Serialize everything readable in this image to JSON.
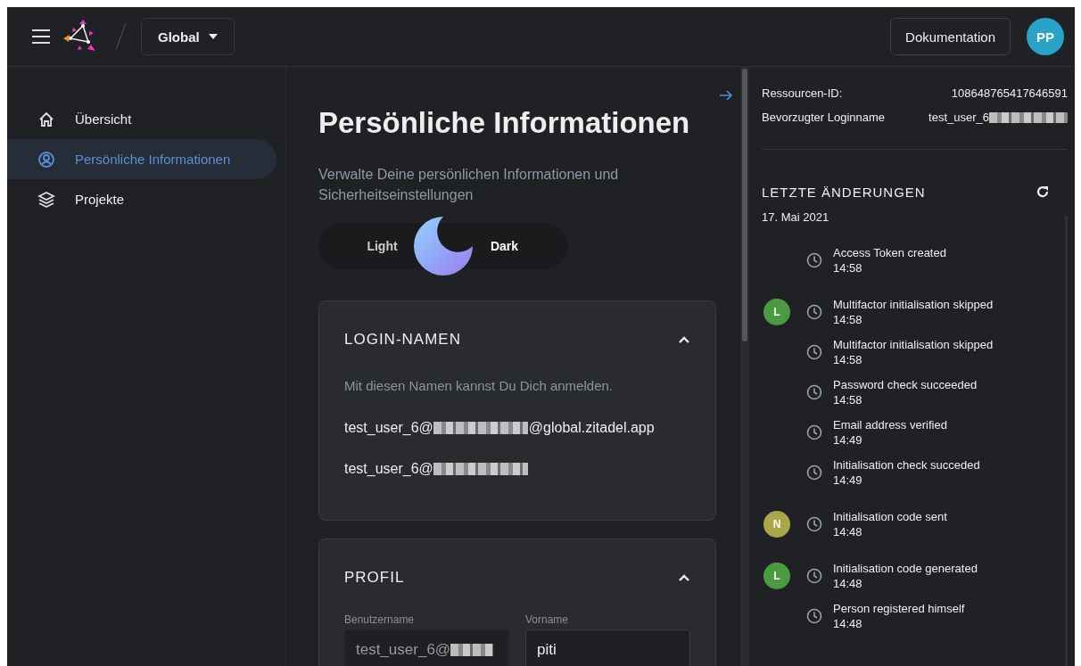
{
  "topbar": {
    "org_button": "Global",
    "docs_button": "Dokumentation",
    "avatar": "PP"
  },
  "sidebar": {
    "items": [
      {
        "label": "Übersicht",
        "kind": "home",
        "selected": false
      },
      {
        "label": "Persönliche Informationen",
        "kind": "person",
        "selected": true
      },
      {
        "label": "Projekte",
        "kind": "layers",
        "selected": false
      }
    ]
  },
  "main": {
    "title": "Persönliche Informationen",
    "subtitle": "Verwalte Deine persönlichen Informationen und Sicherheitseinstellungen",
    "theme_toggle": {
      "options": [
        {
          "label": "Light",
          "selected": false
        },
        {
          "label": "Dark",
          "selected": true
        }
      ]
    },
    "cards": [
      {
        "kind": "login",
        "title": "LOGIN-NAMEN",
        "expanded": true,
        "description": "Mit diesen Namen kannst Du Dich anmelden.",
        "names": [
          [
            {
              "kind": "text",
              "text": "test_user_6@"
            },
            {
              "kind": "redacted"
            },
            {
              "kind": "text",
              "text": "@global.zitadel.app"
            }
          ],
          [
            {
              "kind": "text",
              "text": "test_user_6@"
            },
            {
              "kind": "redacted"
            }
          ]
        ]
      },
      {
        "kind": "profile",
        "title": "PROFIL",
        "expanded": true,
        "fields": [
          {
            "label": "Benutzername",
            "value": "test_user_6@",
            "redacted": true,
            "disabled": true
          },
          {
            "label": "Vorname",
            "value": "piti",
            "redacted": false,
            "disabled": false
          }
        ]
      }
    ]
  },
  "details": {
    "rows": [
      {
        "label": "Ressourcen-ID:",
        "value": "108648765417646591",
        "redacted": false
      },
      {
        "label": "Bevorzugter Loginname",
        "value": "test_user_6",
        "redacted": true
      }
    ]
  },
  "changes": {
    "title": "LETZTE ÄNDERUNGEN",
    "date": "17. Mai 2021",
    "groups": [
      {
        "events": [
          {
            "text": "Access Token created",
            "time": "14:58"
          }
        ]
      },
      {
        "avatar": {
          "letter": "L",
          "color": "#4a9a42"
        },
        "events": [
          {
            "text": "Multifactor initialisation skipped",
            "time": "14:58"
          },
          {
            "text": "Multifactor initialisation skipped",
            "time": "14:58"
          },
          {
            "text": "Password check succeeded",
            "time": "14:58"
          },
          {
            "text": "Email address verified",
            "time": "14:49"
          },
          {
            "text": "Initialisation check succeded",
            "time": "14:49"
          }
        ]
      },
      {
        "avatar": {
          "letter": "N",
          "color": "#a9a748"
        },
        "events": [
          {
            "text": "Initialisation code sent",
            "time": "14:48"
          }
        ]
      },
      {
        "avatar": {
          "letter": "L",
          "color": "#4a9a42"
        },
        "events": [
          {
            "text": "Initialisation code generated",
            "time": "14:48"
          },
          {
            "text": "Person registered himself",
            "time": "14:48"
          }
        ]
      }
    ]
  }
}
